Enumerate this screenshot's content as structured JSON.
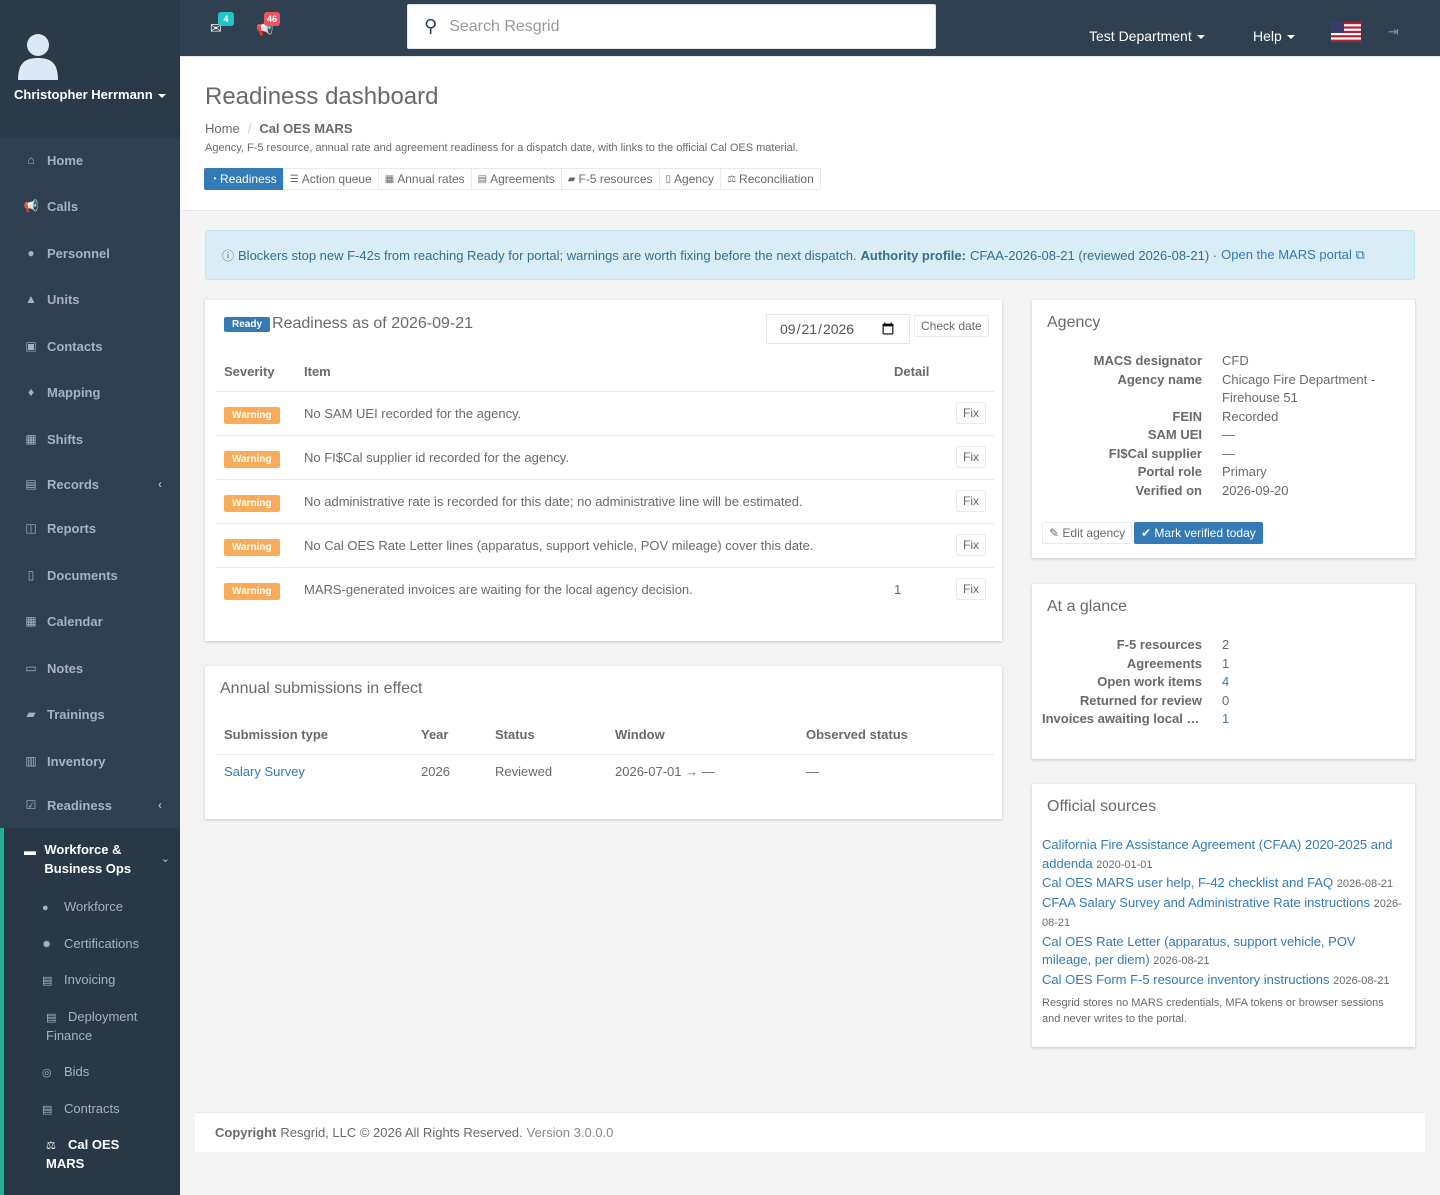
{
  "user": {
    "name": "Christopher Herrmann"
  },
  "sidebar": {
    "items": [
      {
        "label": "Home",
        "icon": "home-icon"
      },
      {
        "label": "Calls",
        "icon": "bullhorn-icon"
      },
      {
        "label": "Personnel",
        "icon": "user-icon"
      },
      {
        "label": "Units",
        "icon": "truck-icon"
      },
      {
        "label": "Contacts",
        "icon": "address-book-icon"
      },
      {
        "label": "Mapping",
        "icon": "map-marker-icon"
      },
      {
        "label": "Shifts",
        "icon": "shifts-icon"
      },
      {
        "label": "Records",
        "icon": "file-icon"
      },
      {
        "label": "Reports",
        "icon": "reports-icon"
      },
      {
        "label": "Documents",
        "icon": "documents-icon"
      },
      {
        "label": "Calendar",
        "icon": "calendar-icon"
      },
      {
        "label": "Notes",
        "icon": "notes-icon"
      },
      {
        "label": "Trainings",
        "icon": "book-icon"
      },
      {
        "label": "Inventory",
        "icon": "barcode-icon"
      },
      {
        "label": "Readiness",
        "icon": "check-square-icon"
      }
    ],
    "active_section": {
      "label": "Workforce & Business Ops",
      "items": [
        {
          "label": "Workforce"
        },
        {
          "label": "Certifications"
        },
        {
          "label": "Invoicing"
        },
        {
          "label": "Deployment Finance"
        },
        {
          "label": "Bids"
        },
        {
          "label": "Contracts"
        },
        {
          "label": "Cal OES MARS"
        }
      ]
    }
  },
  "topbar": {
    "messages_count": "4",
    "alerts_count": "46",
    "search_placeholder": "Search Resgrid",
    "department": "Test Department",
    "help": "Help"
  },
  "page": {
    "title": "Readiness dashboard",
    "breadcrumb_home": "Home",
    "breadcrumb_current": "Cal OES MARS",
    "description": "Agency, F-5 resource, annual rate and agreement readiness for a dispatch date, with links to the official Cal OES material.",
    "tabs": [
      "Readiness",
      "Action queue",
      "Annual rates",
      "Agreements",
      "F-5 resources",
      "Agency",
      "Reconciliation"
    ]
  },
  "alert": {
    "text": "Blockers stop new F-42s from reaching Ready for portal; warnings are worth fixing before the next dispatch.",
    "authority_label": "Authority profile:",
    "authority_value": "CFAA-2026-08-21 (reviewed 2026-08-21) ·",
    "portal_link": "Open the MARS portal"
  },
  "readiness": {
    "status": "Ready",
    "title": "Readiness as of 2026-09-21",
    "date_value": "2026-09-21",
    "check_button": "Check date",
    "columns": [
      "Severity",
      "Item",
      "Detail"
    ],
    "fix_label": "Fix",
    "rows": [
      {
        "severity": "Warning",
        "item": "No SAM UEI recorded for the agency.",
        "detail": ""
      },
      {
        "severity": "Warning",
        "item": "No FI$Cal supplier id recorded for the agency.",
        "detail": ""
      },
      {
        "severity": "Warning",
        "item": "No administrative rate is recorded for this date; no administrative line will be estimated.",
        "detail": ""
      },
      {
        "severity": "Warning",
        "item": "No Cal OES Rate Letter lines (apparatus, support vehicle, POV mileage) cover this date.",
        "detail": ""
      },
      {
        "severity": "Warning",
        "item": "MARS-generated invoices are waiting for the local agency decision.",
        "detail": "1"
      }
    ]
  },
  "annual": {
    "title": "Annual submissions in effect",
    "columns": [
      "Submission type",
      "Year",
      "Status",
      "Window",
      "Observed status"
    ],
    "rows": [
      {
        "type": "Salary Survey",
        "year": "2026",
        "status": "Reviewed",
        "window": "2026-07-01 → —",
        "observed": "—"
      }
    ]
  },
  "agency": {
    "title": "Agency",
    "fields": [
      {
        "label": "MACS designator",
        "value": "CFD"
      },
      {
        "label": "Agency name",
        "value": "Chicago Fire Department - Firehouse 51"
      },
      {
        "label": "FEIN",
        "value": "Recorded"
      },
      {
        "label": "SAM UEI",
        "value": "—"
      },
      {
        "label": "FI$Cal supplier",
        "value": "—"
      },
      {
        "label": "Portal role",
        "value": "Primary"
      },
      {
        "label": "Verified on",
        "value": "2026-09-20"
      }
    ],
    "edit_button": "Edit agency",
    "verify_button": "Mark verified today"
  },
  "glance": {
    "title": "At a glance",
    "fields": [
      {
        "label": "F-5 resources",
        "value": "2",
        "link": false
      },
      {
        "label": "Agreements",
        "value": "1",
        "link": false
      },
      {
        "label": "Open work items",
        "value": "4",
        "link": true
      },
      {
        "label": "Returned for review",
        "value": "0",
        "link": false
      },
      {
        "label": "Invoices awaiting local decision",
        "value": "1",
        "link": true
      }
    ]
  },
  "sources": {
    "title": "Official sources",
    "items": [
      {
        "label": "California Fire Assistance Agreement (CFAA) 2020-2025 and addenda",
        "date": "2020-01-01"
      },
      {
        "label": "Cal OES MARS user help, F-42 checklist and FAQ",
        "date": "2026-08-21"
      },
      {
        "label": "CFAA Salary Survey and Administrative Rate instructions",
        "date": "2026-08-21"
      },
      {
        "label": "Cal OES Rate Letter (apparatus, support vehicle, POV mileage, per diem)",
        "date": "2026-08-21"
      },
      {
        "label": "Cal OES Form F-5 resource inventory instructions",
        "date": "2026-08-21"
      }
    ],
    "note": "Resgrid stores no MARS credentials, MFA tokens or browser sessions and never writes to the portal."
  },
  "footer": {
    "copyright_label": "Copyright",
    "copyright_text": "Resgrid, LLC © 2026 All Rights Reserved.",
    "version": "Version 3.0.0.0"
  },
  "colors": {
    "sidebar_bg": "#2f4050",
    "primary": "#337ab7",
    "warning": "#f8ac59",
    "alert_bg": "#d9edf7",
    "badge_teal": "#23c6c8",
    "badge_red": "#ed5565"
  }
}
